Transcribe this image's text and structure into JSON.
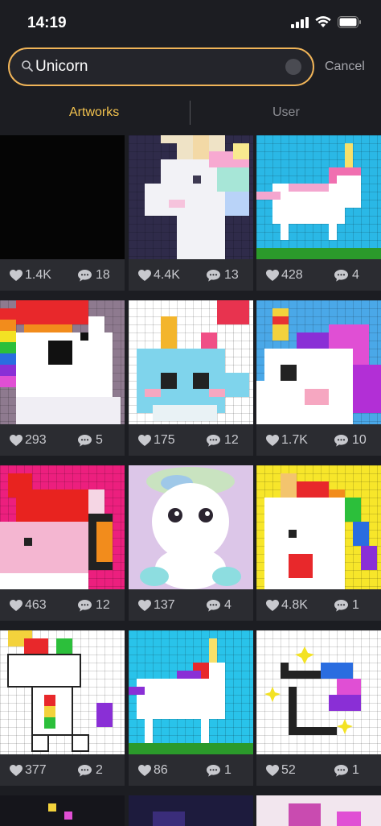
{
  "status_bar": {
    "time": "14:19"
  },
  "search": {
    "value": "Unicorn",
    "cancel_label": "Cancel"
  },
  "tabs": [
    {
      "label": "Artworks",
      "active": true
    },
    {
      "label": "User",
      "active": false
    }
  ],
  "colors": {
    "accent": "#f2c24e",
    "search_border": "#f0b458",
    "background": "#1c1d22",
    "card": "#2b2c31"
  },
  "artworks": [
    {
      "likes": "1.4K",
      "comments": "18",
      "subject": "black-canvas"
    },
    {
      "likes": "4.4K",
      "comments": "13",
      "subject": "unicorn-head-purple-bg"
    },
    {
      "likes": "428",
      "comments": "4",
      "subject": "unicorn-running-blue-bg"
    },
    {
      "likes": "293",
      "comments": "5",
      "subject": "unicorn-rainbow-mane"
    },
    {
      "likes": "175",
      "comments": "12",
      "subject": "narwhal-heart"
    },
    {
      "likes": "1.7K",
      "comments": "10",
      "subject": "unicorn-pink-mane"
    },
    {
      "likes": "463",
      "comments": "12",
      "subject": "unicorn-pink-bg"
    },
    {
      "likes": "137",
      "comments": "4",
      "subject": "fluffy-unicorn-sitting"
    },
    {
      "likes": "4.8K",
      "comments": "1",
      "subject": "unicorn-yellow-bg"
    },
    {
      "likes": "377",
      "comments": "2",
      "subject": "dabbing-unicorn"
    },
    {
      "likes": "86",
      "comments": "1",
      "subject": "unicorn-walking-blue-bg"
    },
    {
      "likes": "52",
      "comments": "1",
      "subject": "unicorn-outline-stars"
    }
  ]
}
